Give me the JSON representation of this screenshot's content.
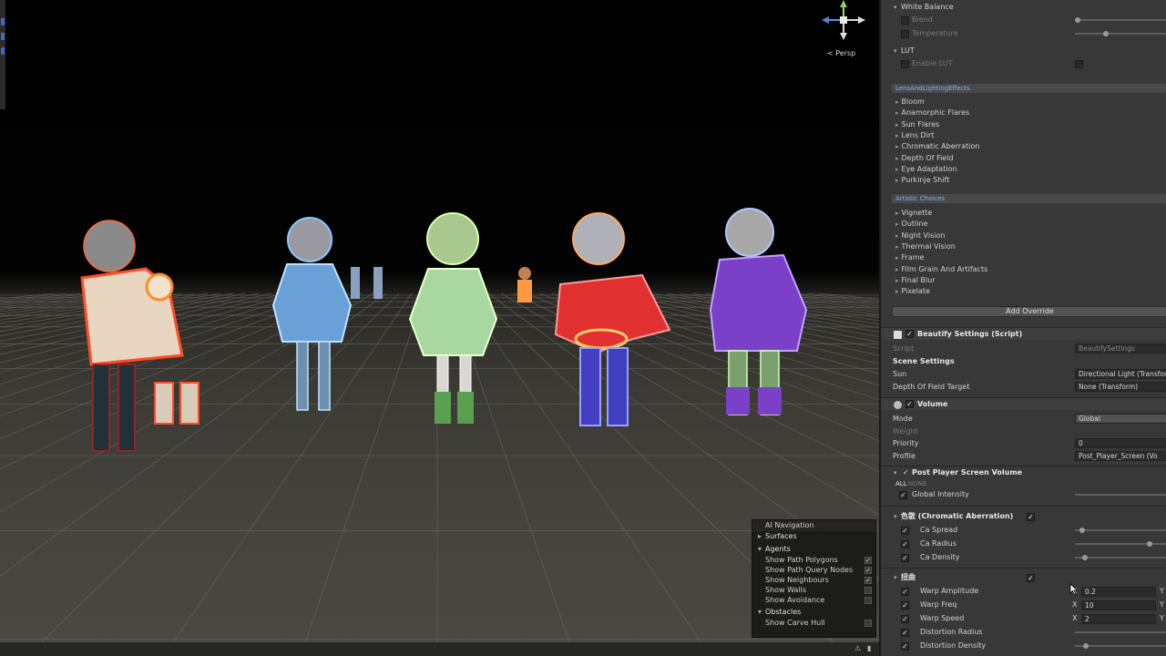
{
  "scene": {
    "persp_label": "< Persp",
    "ai_nav": {
      "title": "AI Navigation",
      "surfaces_label": "Surfaces",
      "agents_label": "Agents",
      "agent_rows": [
        {
          "label": "Show Path Polygons",
          "checked": true
        },
        {
          "label": "Show Path Query Nodes",
          "checked": true
        },
        {
          "label": "Show Neighbours",
          "checked": true
        },
        {
          "label": "Show Walls",
          "checked": false
        },
        {
          "label": "Show Avoidance",
          "checked": false
        }
      ],
      "obstacles_label": "Obstacles",
      "obstacle_rows": [
        {
          "label": "Show Carve Hull",
          "checked": false
        }
      ]
    }
  },
  "inspector": {
    "white_balance": {
      "header": "White Balance",
      "blend": "Blend",
      "temperature": "Temperature"
    },
    "lut": {
      "header": "LUT",
      "enable": "Enable LUT"
    },
    "lens_category": "LensAndLightingEffects",
    "lens_items": [
      "Bloom",
      "Anamorphic Flares",
      "Sun Flares",
      "Lens Dirt",
      "Chromatic Aberration",
      "Depth Of Field",
      "Eye Adaptation",
      "Purkinje Shift"
    ],
    "artistic_category": "Artistic Choices",
    "artistic_items": [
      "Vignette",
      "Outline",
      "Night Vision",
      "Thermal Vision",
      "Frame",
      "Film Grain And Artifacts",
      "Final Blur",
      "Pixelate"
    ],
    "add_override": "Add Override",
    "beautify": {
      "title": "Beautify Settings (Script)",
      "script_label": "Script",
      "script_value": "BeautifySettings",
      "scene_settings": "Scene Settings",
      "sun_label": "Sun",
      "sun_value": "Directional Light (Transform)",
      "dof_label": "Depth Of Field Target",
      "dof_value": "None (Transform)"
    },
    "volume": {
      "title": "Volume",
      "mode_label": "Mode",
      "mode_value": "Global",
      "weight_label": "Weight",
      "priority_label": "Priority",
      "priority_value": "0",
      "profile_label": "Profile",
      "profile_value": "Post_Player_Screen (Vo"
    },
    "post_player": {
      "title": "Post Player Screen Volume",
      "all": "ALL",
      "none": "NONE",
      "global_intensity": "Global Intensity"
    },
    "chromatic": {
      "title": "色散 (Chromatic Aberration)",
      "spread": "Ca Spread",
      "radius": "Ca Radius",
      "density": "Ca Density",
      "spread_level": 0.05,
      "radius_level": 0.82,
      "density_level": 0.08
    },
    "warp": {
      "title": "扭曲",
      "amplitude_label": "Warp Amplitude",
      "amplitude_value": "0.2",
      "freq_label": "Warp Freq",
      "freq_value": "10",
      "speed_label": "Warp Speed",
      "speed_value": "2",
      "distortion_radius": "Distortion Radius",
      "distortion_density": "Distortion Density",
      "x_label": "X",
      "y_label": "Y"
    }
  },
  "colors": {
    "accent_link": "#7cb0ff",
    "panel_bg": "#383838",
    "scene_floor": "#45433d"
  }
}
